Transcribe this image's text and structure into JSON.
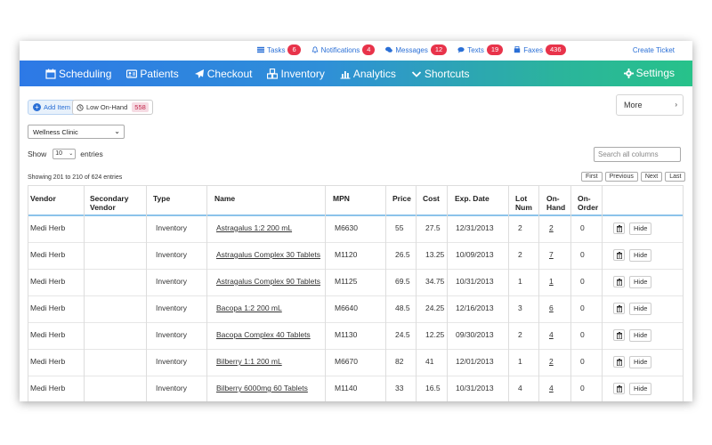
{
  "topbar": {
    "links": [
      {
        "label": "Tasks",
        "count": "6",
        "icon": "list-icon"
      },
      {
        "label": "Notifications",
        "count": "4",
        "icon": "bell-icon"
      },
      {
        "label": "Messages",
        "count": "12",
        "icon": "chat-icon"
      },
      {
        "label": "Texts",
        "count": "19",
        "icon": "comments-icon"
      },
      {
        "label": "Faxes",
        "count": "436",
        "icon": "fax-icon"
      }
    ],
    "create_ticket": "Create Ticket"
  },
  "nav": {
    "items": [
      {
        "label": "Scheduling",
        "icon": "calendar-icon"
      },
      {
        "label": "Patients",
        "icon": "id-card-icon"
      },
      {
        "label": "Checkout",
        "icon": "paper-plane-icon"
      },
      {
        "label": "Inventory",
        "icon": "cubes-icon"
      },
      {
        "label": "Analytics",
        "icon": "bar-chart-icon"
      },
      {
        "label": "Shortcuts",
        "icon": "chevron-down-icon"
      }
    ],
    "settings": "Settings"
  },
  "toolbar": {
    "add_item": "Add Item",
    "low_onhand": "Low On-Hand",
    "low_onhand_count": "558",
    "more": "More",
    "clinic": "Wellness Clinic",
    "show": "Show",
    "entries_value": "10",
    "entries": "entries",
    "search_placeholder": "Search all columns",
    "showing": "Showing 201 to 210 of 624 entries",
    "pager": [
      "First",
      "Previous",
      "Next",
      "Last"
    ]
  },
  "colors": {
    "accent": "#2a6fd6",
    "badge": "#e8334a",
    "nav_start": "#2d79e6",
    "nav_end": "#27c28a"
  },
  "table": {
    "headers": {
      "vendor": "Vendor",
      "secondary_vendor": "Secondary Vendor",
      "type": "Type",
      "name": "Name",
      "mpn": "MPN",
      "price": "Price",
      "cost": "Cost",
      "exp_date": "Exp. Date",
      "lot_num": "Lot Num",
      "on_hand": "On-Hand",
      "on_order": "On-Order"
    },
    "hide_label": "Hide",
    "rows": [
      {
        "vendor": "Medi Herb",
        "secondary_vendor": "",
        "type": "Inventory",
        "name": "Astragalus 1:2 200 mL",
        "mpn": "M6630",
        "price": "55",
        "cost": "27.5",
        "exp_date": "12/31/2013",
        "lot_num": "2",
        "on_hand": "2",
        "on_order": "0"
      },
      {
        "vendor": "Medi Herb",
        "secondary_vendor": "",
        "type": "Inventory",
        "name": "Astragalus Complex 30 Tablets",
        "mpn": "M1120",
        "price": "26.5",
        "cost": "13.25",
        "exp_date": "10/09/2013",
        "lot_num": "2",
        "on_hand": "7",
        "on_order": "0"
      },
      {
        "vendor": "Medi Herb",
        "secondary_vendor": "",
        "type": "Inventory",
        "name": "Astragalus Complex 90 Tablets",
        "mpn": "M1125",
        "price": "69.5",
        "cost": "34.75",
        "exp_date": "10/31/2013",
        "lot_num": "1",
        "on_hand": "1",
        "on_order": "0"
      },
      {
        "vendor": "Medi Herb",
        "secondary_vendor": "",
        "type": "Inventory",
        "name": "Bacopa 1:2 200 mL",
        "mpn": "M6640",
        "price": "48.5",
        "cost": "24.25",
        "exp_date": "12/16/2013",
        "lot_num": "3",
        "on_hand": "6",
        "on_order": "0"
      },
      {
        "vendor": "Medi Herb",
        "secondary_vendor": "",
        "type": "Inventory",
        "name": "Bacopa Complex 40 Tablets",
        "mpn": "M1130",
        "price": "24.5",
        "cost": "12.25",
        "exp_date": "09/30/2013",
        "lot_num": "2",
        "on_hand": "4",
        "on_order": "0"
      },
      {
        "vendor": "Medi Herb",
        "secondary_vendor": "",
        "type": "Inventory",
        "name": "Bilberry 1:1 200 mL",
        "mpn": "M6670",
        "price": "82",
        "cost": "41",
        "exp_date": "12/01/2013",
        "lot_num": "1",
        "on_hand": "2",
        "on_order": "0"
      },
      {
        "vendor": "Medi Herb",
        "secondary_vendor": "",
        "type": "Inventory",
        "name": "Bilberry 6000mg 60 Tablets",
        "mpn": "M1140",
        "price": "33",
        "cost": "16.5",
        "exp_date": "10/31/2013",
        "lot_num": "4",
        "on_hand": "4",
        "on_order": "0"
      }
    ]
  }
}
